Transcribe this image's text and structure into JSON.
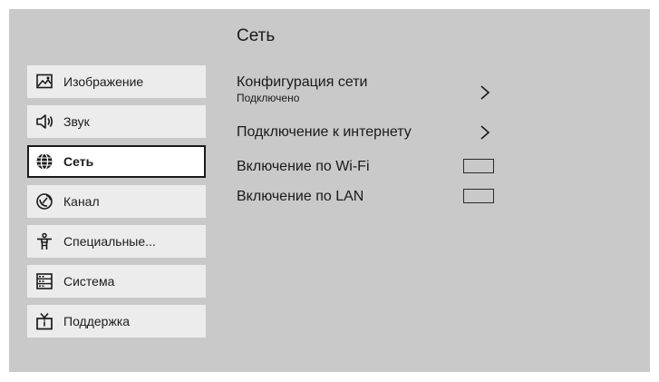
{
  "page": {
    "title": "Сеть"
  },
  "sidebar": {
    "items": [
      {
        "label": "Изображение",
        "icon": "picture-icon",
        "selected": false
      },
      {
        "label": "Звук",
        "icon": "speaker-icon",
        "selected": false
      },
      {
        "label": "Сеть",
        "icon": "globe-icon",
        "selected": true
      },
      {
        "label": "Канал",
        "icon": "satellite-dish-icon",
        "selected": false
      },
      {
        "label": "Специальные...",
        "icon": "accessibility-icon",
        "selected": false
      },
      {
        "label": "Система",
        "icon": "system-icon",
        "selected": false
      },
      {
        "label": "Поддержка",
        "icon": "tv-support-icon",
        "selected": false
      }
    ]
  },
  "settings": {
    "network_config": {
      "label": "Конфигурация сети",
      "status": "Подключено"
    },
    "internet_connection": {
      "label": "Подключение к интернету"
    },
    "wake_on_wifi": {
      "label": "Включение по Wi-Fi",
      "checked": false
    },
    "wake_on_lan": {
      "label": "Включение по LAN",
      "checked": false
    }
  },
  "colors": {
    "screen_background": "#c9c9c9",
    "sidebar_item": "#ececec",
    "selected_item": "#ffffff",
    "text": "#1a1a1a"
  }
}
